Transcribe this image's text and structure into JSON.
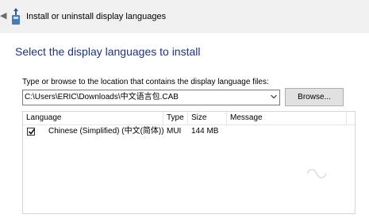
{
  "window": {
    "title": "Install or uninstall display languages",
    "heading": "Select the display languages to install"
  },
  "path": {
    "label": "Type or browse to the location that contains the display language files:",
    "value": "C:\\Users\\ERIC\\Downloads\\中文语言包.CAB"
  },
  "browse_label": "Browse...",
  "list": {
    "columns": [
      "Language",
      "Type",
      "Size",
      "Message"
    ],
    "rows": [
      {
        "checked": true,
        "language": "Chinese (Simplified) (中文(简体))",
        "type": "MUI",
        "size": "144 MB",
        "message": ""
      }
    ]
  },
  "colors": {
    "heading": "#1e3287",
    "titlebar": "#f0f0f0",
    "button": "#e1e1e1"
  },
  "icons": [
    "back-arrow-icon",
    "language-pack-icon",
    "dropdown-arrow-icon",
    "checkmark-icon"
  ]
}
